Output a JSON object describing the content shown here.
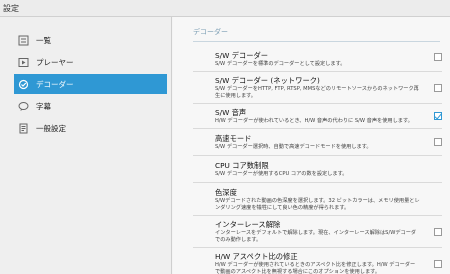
{
  "window": {
    "title": "設定"
  },
  "sidebar": {
    "items": [
      {
        "label": "一覧",
        "icon": "list-icon"
      },
      {
        "label": "プレーヤー",
        "icon": "player-icon"
      },
      {
        "label": "デコーダー",
        "icon": "decoder-icon",
        "active": true
      },
      {
        "label": "字幕",
        "icon": "subtitle-icon"
      },
      {
        "label": "一般設定",
        "icon": "general-settings-icon"
      }
    ]
  },
  "main": {
    "section": "デコーダー",
    "settings": [
      {
        "title": "S/W デコーダー",
        "desc": "S/W デコーダーを標準のデコーダーとして設定します。",
        "checkbox": true,
        "checked": false
      },
      {
        "title": "S/W デコーダー (ネットワーク)",
        "desc": "S/W デコーダーをHTTP, FTP, RTSP, MMSなどのリモートソースからのネットワーク再生に使用します。",
        "checkbox": true,
        "checked": false
      },
      {
        "title": "S/W 音声",
        "desc": "H/W デコーダーが使われているとき、H/W 音声の代わりに S/W 音声を使用します。",
        "checkbox": true,
        "checked": true
      },
      {
        "title": "高速モード",
        "desc": "S/W デコーダー選択時、自動で高速デコードモードを使用します。",
        "checkbox": true,
        "checked": false
      },
      {
        "title": "CPU コア数制限",
        "desc": "S/W デコーダーが使用するCPU コアの数を設定します。",
        "checkbox": false
      },
      {
        "title": "色深度",
        "desc": "S/Wデコードされた動画の色深度を選択します。32 ビットカラーは、メモリ使用量とレンダリング速度を犠牲にして良い色の精度が得られます。",
        "checkbox": false
      },
      {
        "title": "インターレース解除",
        "desc": "インターレースをデフォルトで解除します。現在、インターレース解除はS/Wデコーダでのみ動作します。",
        "checkbox": true,
        "checked": false
      },
      {
        "title": "H/W アスペクト比の修正",
        "desc": "H/W デコーダーが使用されているときのアスペクト比を修正します。H/W デコーダーで動画のアスペクト比を無視する場合にこのオプションを使用します。",
        "checkbox": true,
        "checked": false
      }
    ]
  },
  "colors": {
    "accent": "#2f98d4"
  }
}
